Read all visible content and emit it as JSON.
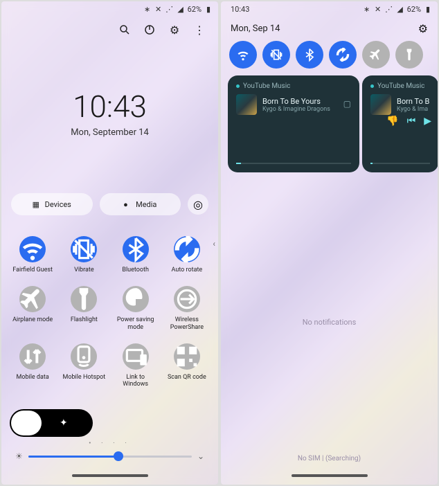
{
  "status": {
    "time": "10:43",
    "battery": "62%",
    "icons": [
      "bluetooth",
      "mute",
      "wifi-off",
      "signal",
      "battery"
    ]
  },
  "left": {
    "clock_time": "10:43",
    "clock_date": "Mon, September 14",
    "pills": {
      "devices": "Devices",
      "media": "Media"
    },
    "toggles": [
      {
        "name": "wifi",
        "label": "Fairfield Guest",
        "on": true,
        "icon": "wifi"
      },
      {
        "name": "vibrate",
        "label": "Vibrate",
        "on": true,
        "icon": "vibrate"
      },
      {
        "name": "bluetooth",
        "label": "Bluetooth",
        "on": true,
        "icon": "bluetooth"
      },
      {
        "name": "autorotate",
        "label": "Auto rotate",
        "on": true,
        "icon": "rotate"
      },
      {
        "name": "airplane",
        "label": "Airplane mode",
        "on": false,
        "icon": "airplane"
      },
      {
        "name": "flashlight",
        "label": "Flashlight",
        "on": false,
        "icon": "flashlight"
      },
      {
        "name": "powersave",
        "label": "Power saving mode",
        "on": false,
        "icon": "leaf"
      },
      {
        "name": "powershare",
        "label": "Wireless PowerShare",
        "on": false,
        "icon": "share"
      },
      {
        "name": "mobiledata",
        "label": "Mobile data",
        "on": false,
        "icon": "data"
      },
      {
        "name": "hotspot",
        "label": "Mobile Hotspot",
        "on": false,
        "icon": "hotspot"
      },
      {
        "name": "linkwin",
        "label": "Link to Windows",
        "on": false,
        "icon": "windows"
      },
      {
        "name": "scanqr",
        "label": "Scan QR code",
        "on": false,
        "icon": "qr"
      }
    ],
    "brightness": {
      "value": 55
    }
  },
  "right": {
    "date": "Mon, Sep 14",
    "quick": [
      {
        "name": "wifi",
        "on": true
      },
      {
        "name": "vibrate",
        "on": true
      },
      {
        "name": "bluetooth",
        "on": true
      },
      {
        "name": "autorotate",
        "on": true
      },
      {
        "name": "airplane",
        "on": false
      },
      {
        "name": "flashlight",
        "on": false
      }
    ],
    "media": {
      "source": "YouTube Music",
      "title": "Born To Be Yours",
      "artist": "Kygo & Imagine Dragons",
      "title2": "Born To B",
      "artist2": "Kygo & Ima"
    },
    "no_notifications": "No notifications",
    "sim": "No SIM | (Searching)"
  }
}
